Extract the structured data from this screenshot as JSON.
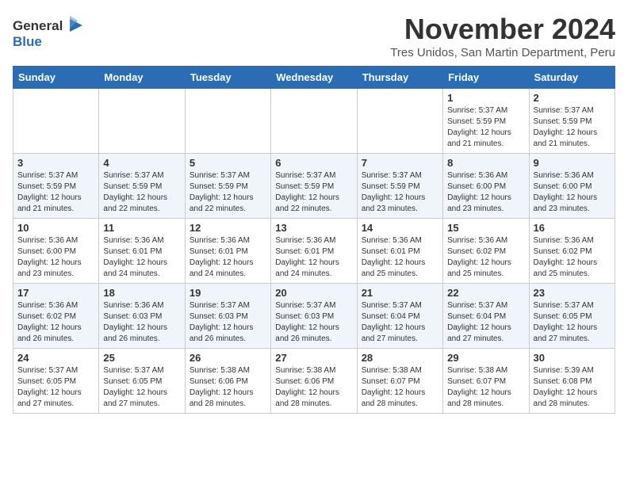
{
  "header": {
    "logo_general": "General",
    "logo_blue": "Blue",
    "month_title": "November 2024",
    "location": "Tres Unidos, San Martin Department, Peru"
  },
  "weekdays": [
    "Sunday",
    "Monday",
    "Tuesday",
    "Wednesday",
    "Thursday",
    "Friday",
    "Saturday"
  ],
  "weeks": [
    [
      {
        "day": "",
        "info": ""
      },
      {
        "day": "",
        "info": ""
      },
      {
        "day": "",
        "info": ""
      },
      {
        "day": "",
        "info": ""
      },
      {
        "day": "",
        "info": ""
      },
      {
        "day": "1",
        "info": "Sunrise: 5:37 AM\nSunset: 5:59 PM\nDaylight: 12 hours\nand 21 minutes."
      },
      {
        "day": "2",
        "info": "Sunrise: 5:37 AM\nSunset: 5:59 PM\nDaylight: 12 hours\nand 21 minutes."
      }
    ],
    [
      {
        "day": "3",
        "info": "Sunrise: 5:37 AM\nSunset: 5:59 PM\nDaylight: 12 hours\nand 21 minutes."
      },
      {
        "day": "4",
        "info": "Sunrise: 5:37 AM\nSunset: 5:59 PM\nDaylight: 12 hours\nand 22 minutes."
      },
      {
        "day": "5",
        "info": "Sunrise: 5:37 AM\nSunset: 5:59 PM\nDaylight: 12 hours\nand 22 minutes."
      },
      {
        "day": "6",
        "info": "Sunrise: 5:37 AM\nSunset: 5:59 PM\nDaylight: 12 hours\nand 22 minutes."
      },
      {
        "day": "7",
        "info": "Sunrise: 5:37 AM\nSunset: 5:59 PM\nDaylight: 12 hours\nand 23 minutes."
      },
      {
        "day": "8",
        "info": "Sunrise: 5:36 AM\nSunset: 6:00 PM\nDaylight: 12 hours\nand 23 minutes."
      },
      {
        "day": "9",
        "info": "Sunrise: 5:36 AM\nSunset: 6:00 PM\nDaylight: 12 hours\nand 23 minutes."
      }
    ],
    [
      {
        "day": "10",
        "info": "Sunrise: 5:36 AM\nSunset: 6:00 PM\nDaylight: 12 hours\nand 23 minutes."
      },
      {
        "day": "11",
        "info": "Sunrise: 5:36 AM\nSunset: 6:01 PM\nDaylight: 12 hours\nand 24 minutes."
      },
      {
        "day": "12",
        "info": "Sunrise: 5:36 AM\nSunset: 6:01 PM\nDaylight: 12 hours\nand 24 minutes."
      },
      {
        "day": "13",
        "info": "Sunrise: 5:36 AM\nSunset: 6:01 PM\nDaylight: 12 hours\nand 24 minutes."
      },
      {
        "day": "14",
        "info": "Sunrise: 5:36 AM\nSunset: 6:01 PM\nDaylight: 12 hours\nand 25 minutes."
      },
      {
        "day": "15",
        "info": "Sunrise: 5:36 AM\nSunset: 6:02 PM\nDaylight: 12 hours\nand 25 minutes."
      },
      {
        "day": "16",
        "info": "Sunrise: 5:36 AM\nSunset: 6:02 PM\nDaylight: 12 hours\nand 25 minutes."
      }
    ],
    [
      {
        "day": "17",
        "info": "Sunrise: 5:36 AM\nSunset: 6:02 PM\nDaylight: 12 hours\nand 26 minutes."
      },
      {
        "day": "18",
        "info": "Sunrise: 5:36 AM\nSunset: 6:03 PM\nDaylight: 12 hours\nand 26 minutes."
      },
      {
        "day": "19",
        "info": "Sunrise: 5:37 AM\nSunset: 6:03 PM\nDaylight: 12 hours\nand 26 minutes."
      },
      {
        "day": "20",
        "info": "Sunrise: 5:37 AM\nSunset: 6:03 PM\nDaylight: 12 hours\nand 26 minutes."
      },
      {
        "day": "21",
        "info": "Sunrise: 5:37 AM\nSunset: 6:04 PM\nDaylight: 12 hours\nand 27 minutes."
      },
      {
        "day": "22",
        "info": "Sunrise: 5:37 AM\nSunset: 6:04 PM\nDaylight: 12 hours\nand 27 minutes."
      },
      {
        "day": "23",
        "info": "Sunrise: 5:37 AM\nSunset: 6:05 PM\nDaylight: 12 hours\nand 27 minutes."
      }
    ],
    [
      {
        "day": "24",
        "info": "Sunrise: 5:37 AM\nSunset: 6:05 PM\nDaylight: 12 hours\nand 27 minutes."
      },
      {
        "day": "25",
        "info": "Sunrise: 5:37 AM\nSunset: 6:05 PM\nDaylight: 12 hours\nand 27 minutes."
      },
      {
        "day": "26",
        "info": "Sunrise: 5:38 AM\nSunset: 6:06 PM\nDaylight: 12 hours\nand 28 minutes."
      },
      {
        "day": "27",
        "info": "Sunrise: 5:38 AM\nSunset: 6:06 PM\nDaylight: 12 hours\nand 28 minutes."
      },
      {
        "day": "28",
        "info": "Sunrise: 5:38 AM\nSunset: 6:07 PM\nDaylight: 12 hours\nand 28 minutes."
      },
      {
        "day": "29",
        "info": "Sunrise: 5:38 AM\nSunset: 6:07 PM\nDaylight: 12 hours\nand 28 minutes."
      },
      {
        "day": "30",
        "info": "Sunrise: 5:39 AM\nSunset: 6:08 PM\nDaylight: 12 hours\nand 28 minutes."
      }
    ]
  ]
}
